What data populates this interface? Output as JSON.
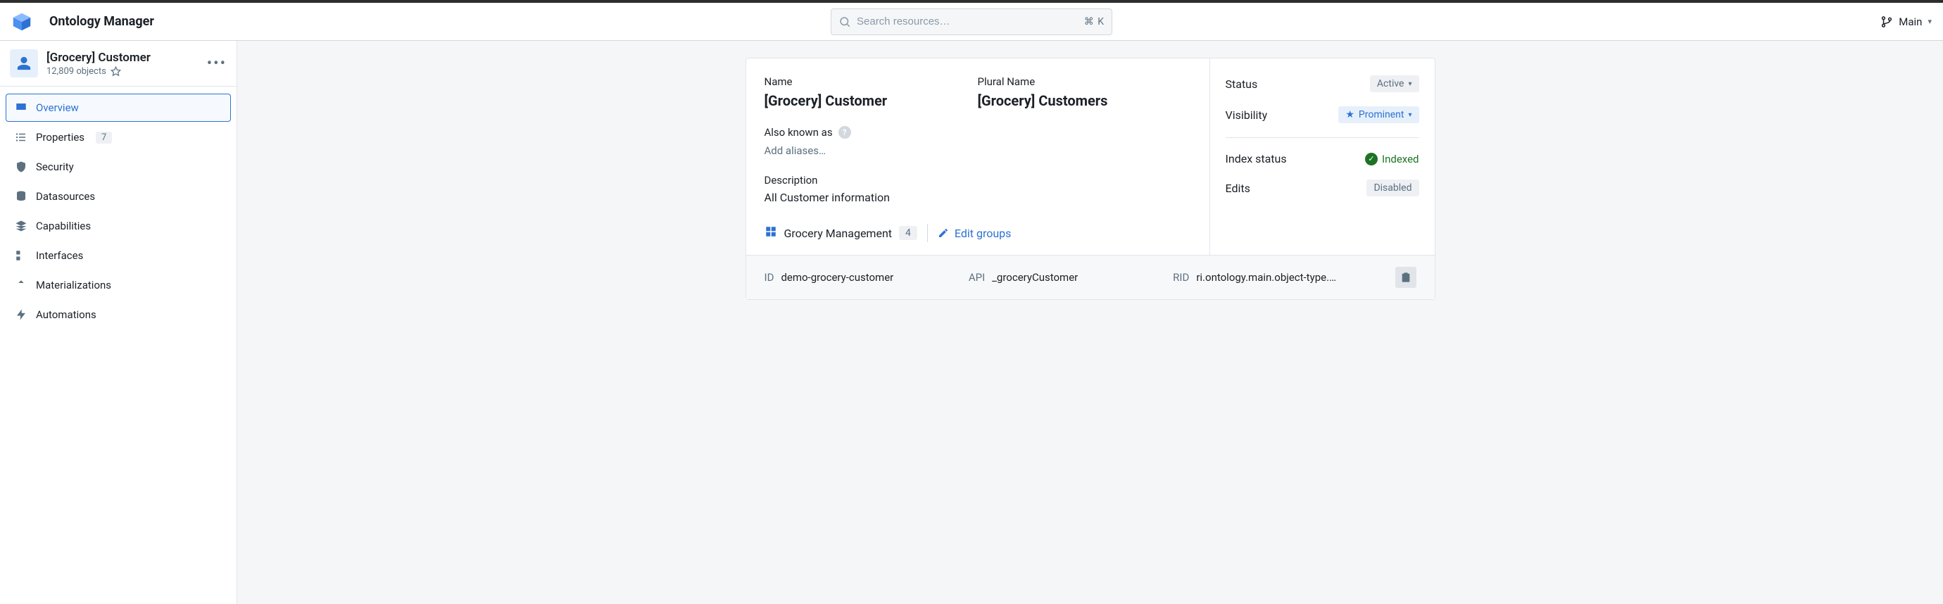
{
  "header": {
    "title": "Ontology Manager",
    "branch_label": "Main"
  },
  "search": {
    "placeholder": "Search resources…",
    "shortcut": "⌘ K"
  },
  "entity": {
    "title": "[Grocery] Customer",
    "count_label": "12,809 objects"
  },
  "sidebar": {
    "items": [
      {
        "label": "Overview"
      },
      {
        "label": "Properties",
        "badge": "7"
      },
      {
        "label": "Security"
      },
      {
        "label": "Datasources"
      },
      {
        "label": "Capabilities"
      },
      {
        "label": "Interfaces"
      },
      {
        "label": "Materializations"
      },
      {
        "label": "Automations"
      }
    ]
  },
  "details": {
    "name_label": "Name",
    "name_value": "[Grocery] Customer",
    "plural_label": "Plural Name",
    "plural_value": "[Grocery] Customers",
    "aka_label": "Also known as",
    "aka_placeholder": "Add aliases…",
    "desc_label": "Description",
    "desc_value": "All Customer information",
    "group_name": "Grocery Management",
    "group_count": "4",
    "edit_groups_label": "Edit groups"
  },
  "status": {
    "status_label": "Status",
    "status_value": "Active",
    "visibility_label": "Visibility",
    "visibility_value": "Prominent",
    "index_label": "Index status",
    "index_value": "Indexed",
    "edits_label": "Edits",
    "edits_value": "Disabled"
  },
  "footer": {
    "id_label": "ID",
    "id_value": "demo-grocery-customer",
    "api_label": "API",
    "api_value": "_groceryCustomer",
    "rid_label": "RID",
    "rid_value": "ri.ontology.main.object-type.…"
  }
}
